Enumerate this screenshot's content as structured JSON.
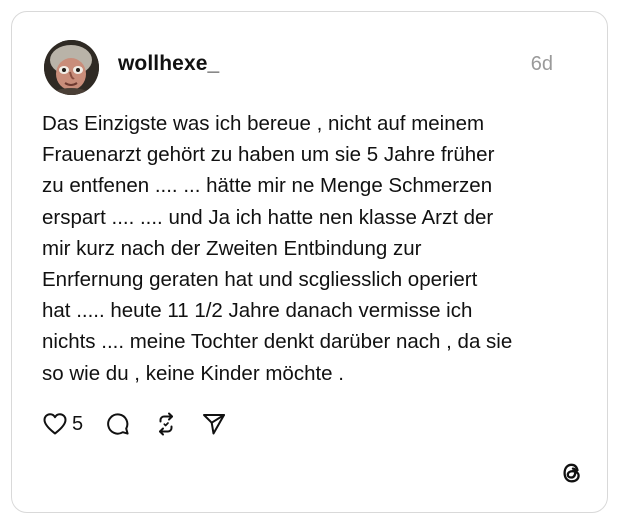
{
  "post": {
    "username": "wollhexe_",
    "timestamp": "6d",
    "text": "Das Einzigste was ich bereue , nicht auf meinem\nFrauenarzt gehört zu haben um sie 5 Jahre früher\nzu entfenen .... ... hätte mir ne Menge Schmerzen\nerspart .... .... und Ja ich hatte nen klasse Arzt der\nmir kurz nach der Zweiten Entbindung zur\nEnrfernung geraten hat und scgliesslich operiert\nhat ..... heute 11 1/2 Jahre danach vermisse  ich\nnichts .... meine Tochter denkt darüber nach , da sie\nso wie du , keine Kinder möchte ."
  },
  "actions": {
    "like_icon": "heart-icon",
    "like_count": "5",
    "reply_icon": "comment-icon",
    "repost_icon": "repost-icon",
    "share_icon": "send-icon"
  },
  "brand": {
    "logo_icon": "threads-logo-icon"
  },
  "colors": {
    "text": "#111111",
    "muted": "#9a9a9a",
    "border": "#d9d9d9"
  }
}
